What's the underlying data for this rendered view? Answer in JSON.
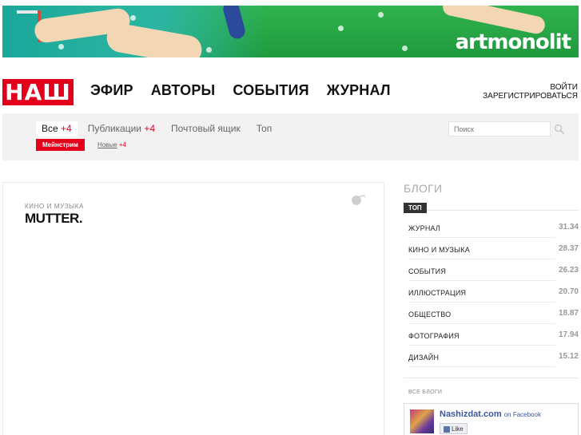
{
  "banner": {
    "brand": "artmonolit"
  },
  "header": {
    "logo": "НАШ",
    "nav": [
      "ЭФИР",
      "АВТОРЫ",
      "СОБЫТИЯ",
      "ЖУРНАЛ"
    ],
    "login": "ВОЙТИ",
    "register": "ЗАРЕГИСТРИРОВАТЬСЯ"
  },
  "subnav": {
    "tabs": [
      {
        "label": "Все",
        "plus": "+4"
      },
      {
        "label": "Публикации",
        "plus": "+4"
      },
      {
        "label": "Почтовый ящик",
        "plus": ""
      },
      {
        "label": "Топ",
        "plus": ""
      }
    ],
    "pill": "Мейнстрим",
    "new_label": "Новые",
    "new_plus": "+4",
    "search_placeholder": "Поиск"
  },
  "article": {
    "category": "КИНО И МУЗЫКА",
    "title": "MUTTER."
  },
  "sidebar": {
    "title": "БЛОГИ",
    "top_label": "ТОП",
    "blogs": [
      {
        "name": "ЖУРНАЛ",
        "score": "31.34"
      },
      {
        "name": "КИНО И МУЗЫКА",
        "score": "28.37"
      },
      {
        "name": "СОБЫТИЯ",
        "score": "26.23"
      },
      {
        "name": "ИЛЛЮСТРАЦИЯ",
        "score": "20.70"
      },
      {
        "name": "ОБЩЕСТВО",
        "score": "18.87"
      },
      {
        "name": "ФОТОГРАФИЯ",
        "score": "17.94"
      },
      {
        "name": "ДИЗАЙН",
        "score": "15.12"
      }
    ],
    "all_blogs": "ВСЕ БЛОГИ",
    "facebook": {
      "page": "Nashizdat.com",
      "on": "on Facebook",
      "like": "Like"
    }
  },
  "colors": {
    "brand_red": "#e3001b",
    "facebook_blue": "#3b5998"
  }
}
